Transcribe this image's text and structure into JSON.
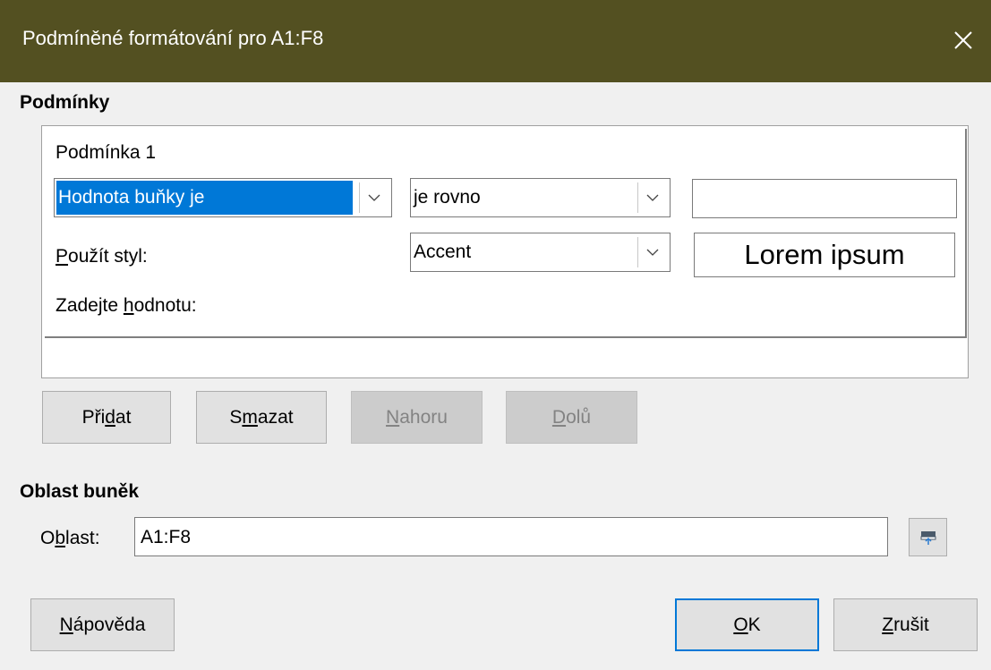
{
  "window": {
    "title": "Podmíněné formátování pro A1:F8"
  },
  "conditions": {
    "heading": "Podmínky",
    "condition1": {
      "label": "Podmínka 1",
      "type_select": "Hodnota buňky je",
      "operator_select": "je rovno",
      "value_input": "",
      "apply_style_label_underlined": "P",
      "apply_style_label_rest": "oužít styl:",
      "style_select": "Accent",
      "style_preview": "Lorem ipsum",
      "enter_value_label_pre": "Zadejte ",
      "enter_value_label_underlined": "h",
      "enter_value_label_post": "odnotu:"
    },
    "buttons": {
      "add": {
        "pre": "Při",
        "u": "d",
        "post": "at"
      },
      "delete": {
        "pre": "S",
        "u": "m",
        "post": "azat"
      },
      "up": {
        "pre": "",
        "u": "N",
        "post": "ahoru"
      },
      "down": {
        "pre": "",
        "u": "D",
        "post": "olů"
      }
    }
  },
  "cell_range": {
    "heading": "Oblast buněk",
    "label": {
      "pre": "O",
      "u": "b",
      "post": "last:"
    },
    "value": "A1:F8"
  },
  "footer": {
    "help": {
      "pre": "",
      "u": "N",
      "post": "ápověda"
    },
    "ok": {
      "pre": "",
      "u": "O",
      "post": "K"
    },
    "cancel": {
      "pre": "",
      "u": "Z",
      "post": "rušit"
    }
  },
  "colors": {
    "titlebar": "#535021",
    "selection": "#0078d7",
    "default_button_border": "#0078d7"
  }
}
